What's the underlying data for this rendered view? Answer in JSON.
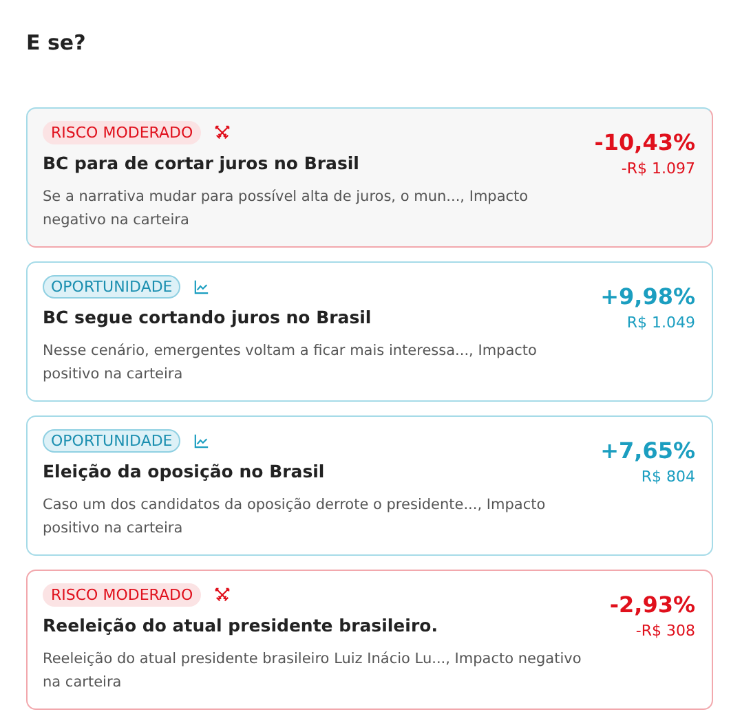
{
  "heading": "E se?",
  "scenarios": [
    {
      "kind": "risk",
      "tag": "RISCO MODERADO",
      "selected": true,
      "title": "BC para de cortar juros no Brasil",
      "description": "Se a narrativa mudar para possível alta de juros, o mun..., Impacto negativo na carteira",
      "percent": "-10,43%",
      "amount": "-R$ 1.097"
    },
    {
      "kind": "opportunity",
      "tag": "OPORTUNIDADE",
      "selected": false,
      "title": "BC segue cortando juros no Brasil",
      "description": "Nesse cenário, emergentes voltam a ficar mais interessa..., Impacto positivo na carteira",
      "percent": "+9,98%",
      "amount": "R$ 1.049"
    },
    {
      "kind": "opportunity",
      "tag": "OPORTUNIDADE",
      "selected": false,
      "title": "Eleição da oposição no Brasil",
      "description": "Caso um dos candidatos da oposição derrote o presidente..., Impacto positivo na carteira",
      "percent": "+7,65%",
      "amount": "R$ 804"
    },
    {
      "kind": "risk",
      "tag": "RISCO MODERADO",
      "selected": false,
      "title": "Reeleição do atual presidente brasileiro.",
      "description": "Reeleição do atual presidente brasileiro Luiz Inácio Lu..., Impacto negativo na carteira",
      "percent": "-2,93%",
      "amount": "-R$ 308"
    }
  ]
}
